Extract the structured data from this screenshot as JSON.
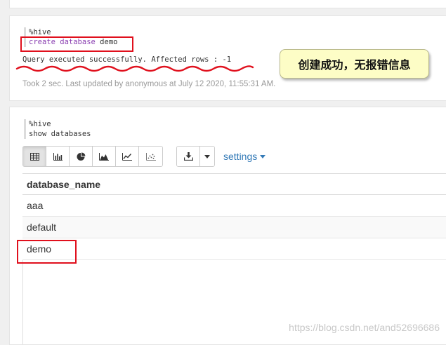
{
  "paragraph1": {
    "code_line1": "%hive",
    "code_keyword1": "create",
    "code_keyword2": "database",
    "code_name": "demo",
    "result": "Query executed successfully. Affected rows : -1",
    "meta": "Took 2 sec. Last updated by anonymous at July 12 2020, 11:55:31 AM."
  },
  "annotation": {
    "callout_text": "创建成功，无报错信息",
    "highlight_color": "#e0101d",
    "callout_color": "#fdfdc6"
  },
  "paragraph2": {
    "code_line1": "%hive",
    "code_line2": "show databases",
    "toolbar": {
      "view_icons": [
        "table-icon",
        "bar-chart-icon",
        "pie-chart-icon",
        "area-chart-icon",
        "line-chart-icon",
        "scatter-chart-icon"
      ],
      "active_view": "table",
      "download_icon": "download-icon",
      "settings_label": "settings"
    },
    "table": {
      "header": "database_name",
      "rows": [
        "aaa",
        "default",
        "demo"
      ]
    }
  },
  "watermark": "https://blog.csdn.net/and52696686",
  "colors": {
    "link": "#337ab7",
    "keyword": "#8a3fb1"
  }
}
